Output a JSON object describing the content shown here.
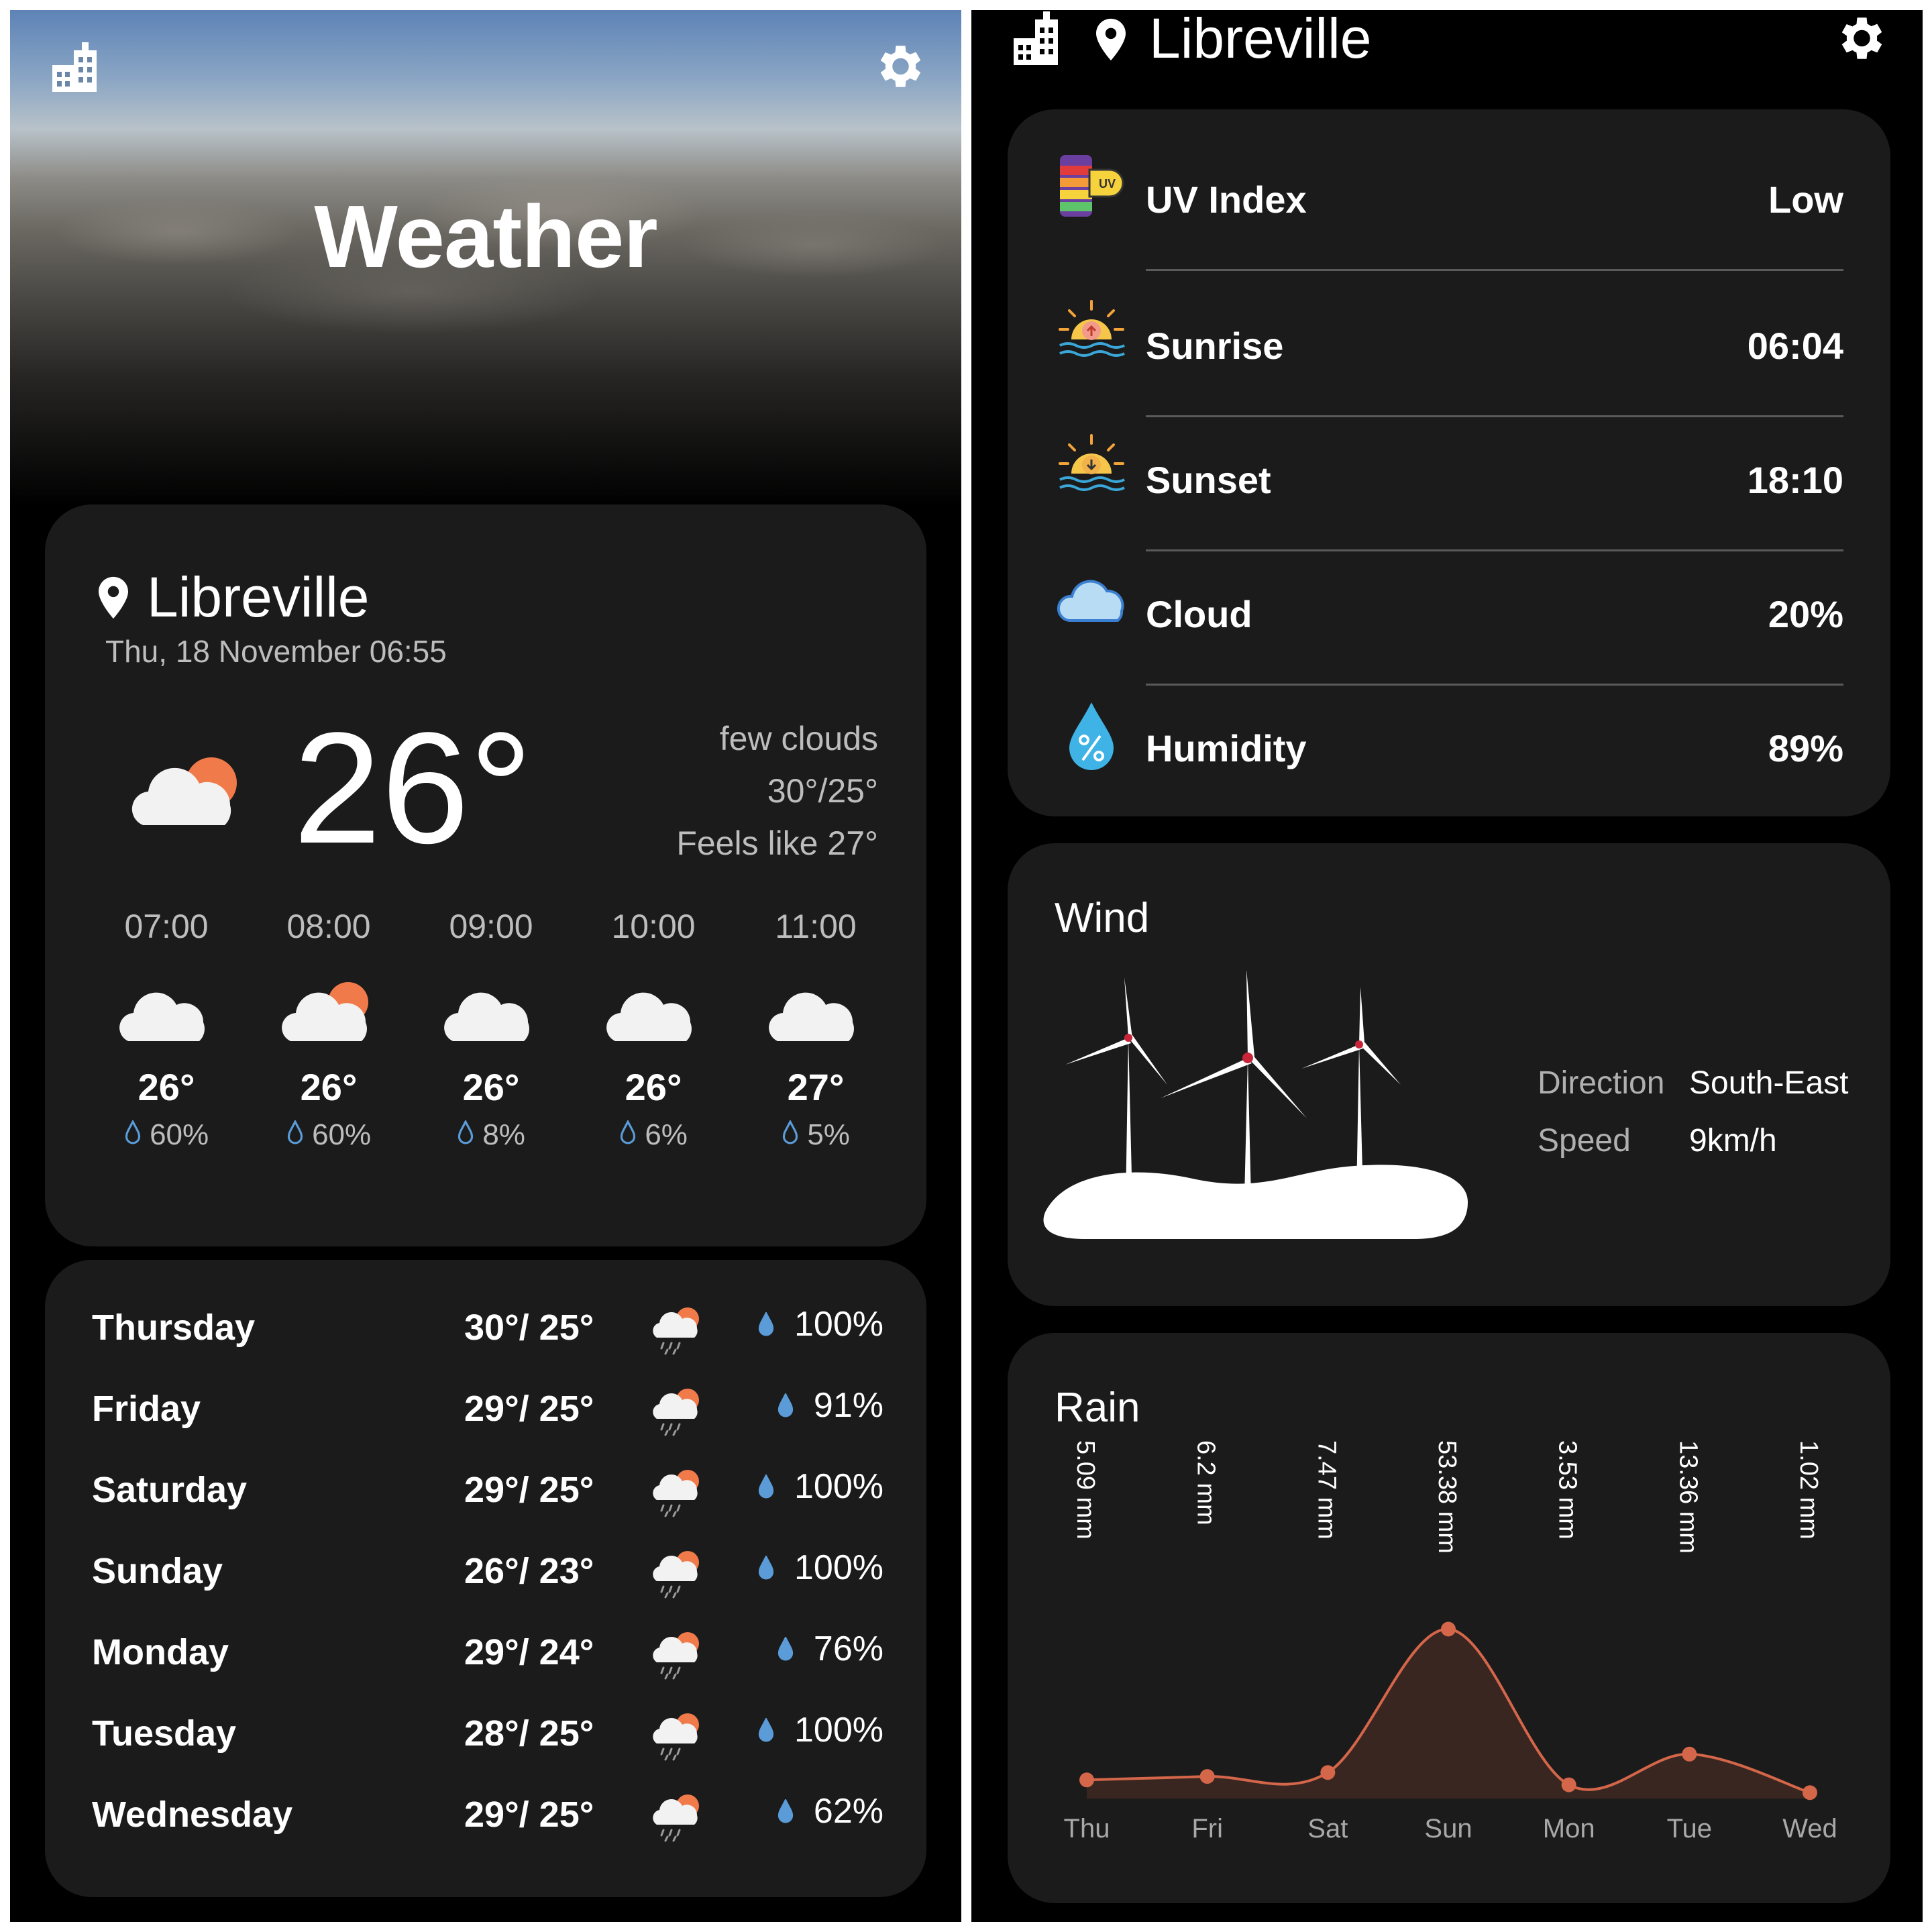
{
  "app": {
    "title": "Weather"
  },
  "current": {
    "location": "Libreville",
    "datetime": "Thu, 18 November 06:55",
    "temperature": "26°",
    "condition": "few clouds",
    "high_low": "30°/25°",
    "feels_like": "Feels like 27°"
  },
  "hourly": [
    {
      "time": "07:00",
      "icon": "cloud-icon",
      "temp": "26°",
      "rain": "60%"
    },
    {
      "time": "08:00",
      "icon": "cloud-sun-icon",
      "temp": "26°",
      "rain": "60%"
    },
    {
      "time": "09:00",
      "icon": "cloud-icon",
      "temp": "26°",
      "rain": "8%"
    },
    {
      "time": "10:00",
      "icon": "cloud-icon",
      "temp": "26°",
      "rain": "6%"
    },
    {
      "time": "11:00",
      "icon": "cloud-icon",
      "temp": "27°",
      "rain": "5%"
    }
  ],
  "daily": [
    {
      "day": "Thursday",
      "temps": "30°/ 25°",
      "rain": "100%"
    },
    {
      "day": "Friday",
      "temps": "29°/ 25°",
      "rain": "91%"
    },
    {
      "day": "Saturday",
      "temps": "29°/ 25°",
      "rain": "100%"
    },
    {
      "day": "Sunday",
      "temps": "26°/ 23°",
      "rain": "100%"
    },
    {
      "day": "Monday",
      "temps": "29°/ 24°",
      "rain": "76%"
    },
    {
      "day": "Tuesday",
      "temps": "28°/ 25°",
      "rain": "100%"
    },
    {
      "day": "Wednesday",
      "temps": "29°/ 25°",
      "rain": "62%"
    }
  ],
  "details": [
    {
      "label": "UV Index",
      "value": "Low",
      "icon": "uv-index-icon"
    },
    {
      "label": "Sunrise",
      "value": "06:04",
      "icon": "sunrise-icon"
    },
    {
      "label": "Sunset",
      "value": "18:10",
      "icon": "sunset-icon"
    },
    {
      "label": "Cloud",
      "value": "20%",
      "icon": "cloud-icon"
    },
    {
      "label": "Humidity",
      "value": "89%",
      "icon": "humidity-drop-icon"
    }
  ],
  "wind": {
    "title": "Wind",
    "direction_label": "Direction",
    "direction": "South-East",
    "speed_label": "Speed",
    "speed": "9km/h"
  },
  "rain": {
    "title": "Rain"
  },
  "chart_data": {
    "type": "area",
    "title": "Rain",
    "categories": [
      "Thu",
      "Fri",
      "Sat",
      "Sun",
      "Mon",
      "Tue",
      "Wed"
    ],
    "values": [
      5.09,
      6.2,
      7.47,
      53.38,
      3.53,
      13.36,
      1.02
    ],
    "labels": [
      "5.09 mm",
      "6.2 mm",
      "7.47 mm",
      "53.38 mm",
      "3.53 mm",
      "13.36 mm",
      "1.02 mm"
    ],
    "ylim": [
      0,
      58
    ],
    "color": "#d4664a"
  },
  "colors": {
    "accent": "#f07a4a",
    "drop": "#5a9bd8",
    "card": "#1b1b1b"
  }
}
